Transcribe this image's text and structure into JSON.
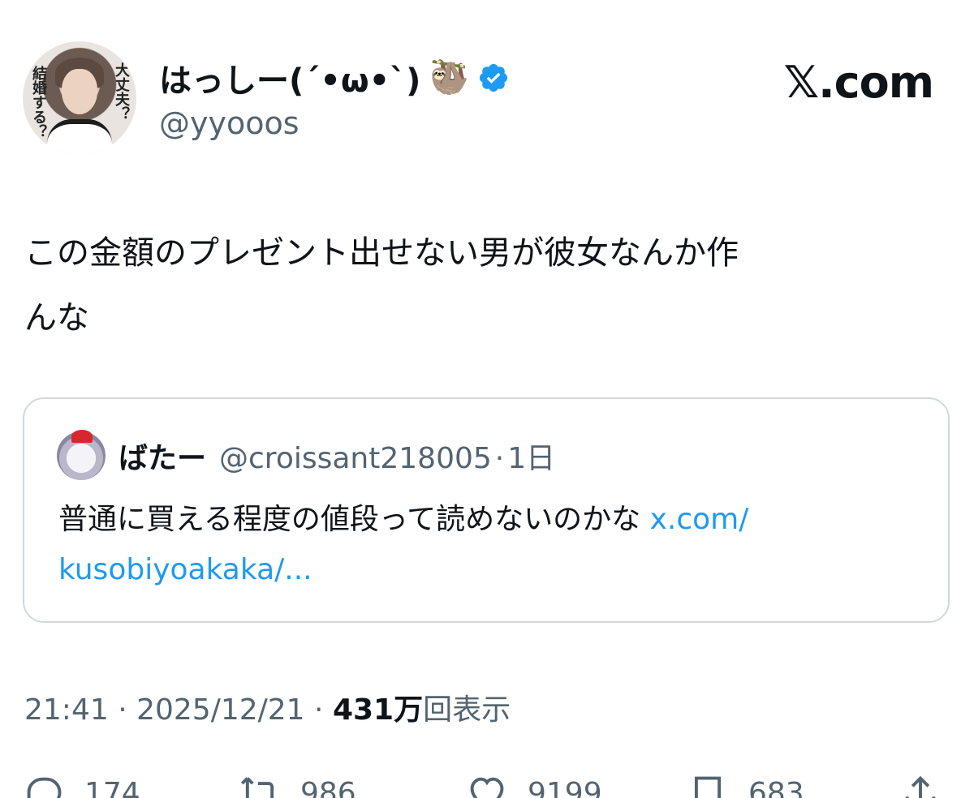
{
  "header": {
    "display_name": "はっしー(´•ω•`)",
    "name_emoji": "🦥",
    "handle": "@yyooos",
    "brand": "𝕏.com",
    "avatar_text_left": "結婚する？",
    "avatar_text_right": "大丈夫？",
    "verified_color": "#1d9bf0"
  },
  "tweet": {
    "text_line1": "この金額のプレゼント出せない男が彼女なんか作",
    "text_line2": "んな"
  },
  "quote": {
    "name": "ばたー",
    "handle": "@croissant218005",
    "separator": "·",
    "time": "1日",
    "text": "普通に買える程度の値段って読めないのかな ",
    "link_part1": "x.com/",
    "link_part2": "kusobiyoakaka/..."
  },
  "meta": {
    "time": "21:41",
    "sep1": " · ",
    "date": "2025/12/21",
    "sep2": " · ",
    "views_num": "431万",
    "views_label": "回表示"
  },
  "actions": {
    "replies": "174",
    "retweets": "986",
    "likes": "9199",
    "bookmarks": "683"
  },
  "colors": {
    "text": "#0f1419",
    "secondary": "#536471",
    "link": "#1d9bf0",
    "border": "#cfd9de"
  }
}
